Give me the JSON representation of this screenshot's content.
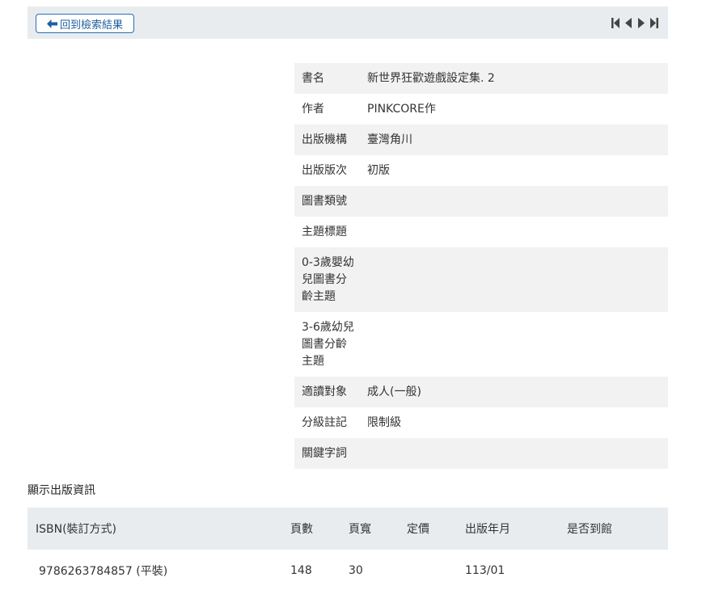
{
  "toolbar": {
    "back_label": "回到檢索結果",
    "pager_icons": [
      "first-page-icon",
      "prev-page-icon",
      "next-page-icon",
      "last-page-icon"
    ]
  },
  "detail": {
    "rows": [
      {
        "label": "書名",
        "value": "新世界狂歡遊戲設定集. 2"
      },
      {
        "label": "作者",
        "value": "PINKCORE作"
      },
      {
        "label": "出版機構",
        "value": "臺灣角川"
      },
      {
        "label": "出版版次",
        "value": "初版"
      },
      {
        "label": "圖書類號",
        "value": ""
      },
      {
        "label": "主題標題",
        "value": ""
      },
      {
        "label": "0-3歲嬰幼兒圖書分齡主題",
        "value": ""
      },
      {
        "label": "3-6歲幼兒圖書分齡主題",
        "value": ""
      },
      {
        "label": "適讀對象",
        "value": "成人(一般)"
      },
      {
        "label": "分級註記",
        "value": "限制級"
      },
      {
        "label": "關鍵字詞",
        "value": ""
      }
    ]
  },
  "publication": {
    "title": "顯示出版資訊",
    "headers": [
      "ISBN(裝訂方式)",
      "頁數",
      "頁寬",
      "定價",
      "出版年月",
      "是否到館"
    ],
    "rows": [
      [
        "9786263784857 (平裝)",
        "148",
        "30",
        "",
        "113/01",
        ""
      ]
    ]
  },
  "colors": {
    "accent": "#2a6fb4",
    "bar_bg": "#e9ecef",
    "row_alt": "#f2f2f2"
  }
}
